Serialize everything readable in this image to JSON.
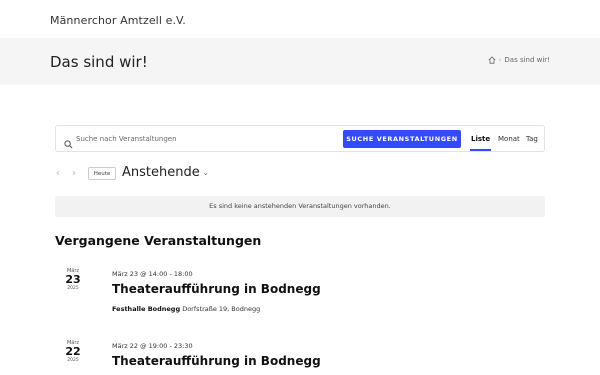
{
  "site": {
    "title": "Männerchor Amtzell e.V."
  },
  "header": {
    "page_title": "Das sind wir!",
    "breadcrumb": [
      "Das sind wir!"
    ]
  },
  "search": {
    "placeholder": "Suche nach Veranstaltungen",
    "button_label": "SUCHE VERANSTALTUNGEN",
    "views": [
      "Liste",
      "Monat",
      "Tag"
    ],
    "active_view": "Liste"
  },
  "nav": {
    "today_label": "Heute",
    "range_label": "Anstehende"
  },
  "notice": "Es sind keine anstehenden Veranstaltungen vorhanden.",
  "past": {
    "heading": "Vergangene Veranstaltungen",
    "events": [
      {
        "month": "März",
        "day": "23",
        "year": "2025",
        "time": "März 23 @ 14:00 - 18:00",
        "title": "Theateraufführung in Bodnegg",
        "venue_name": "Festhalle Bodnegg",
        "venue_address": "Dorfstraße 19, Bodnegg"
      },
      {
        "month": "März",
        "day": "22",
        "year": "2025",
        "time": "März 22 @ 19:00 - 23:30",
        "title": "Theateraufführung in Bodnegg",
        "venue_name": "",
        "venue_address": ""
      }
    ]
  },
  "colors": {
    "accent": "#334aff",
    "header_bg": "#f5f5f5",
    "notice_bg": "#f2f2f2"
  }
}
